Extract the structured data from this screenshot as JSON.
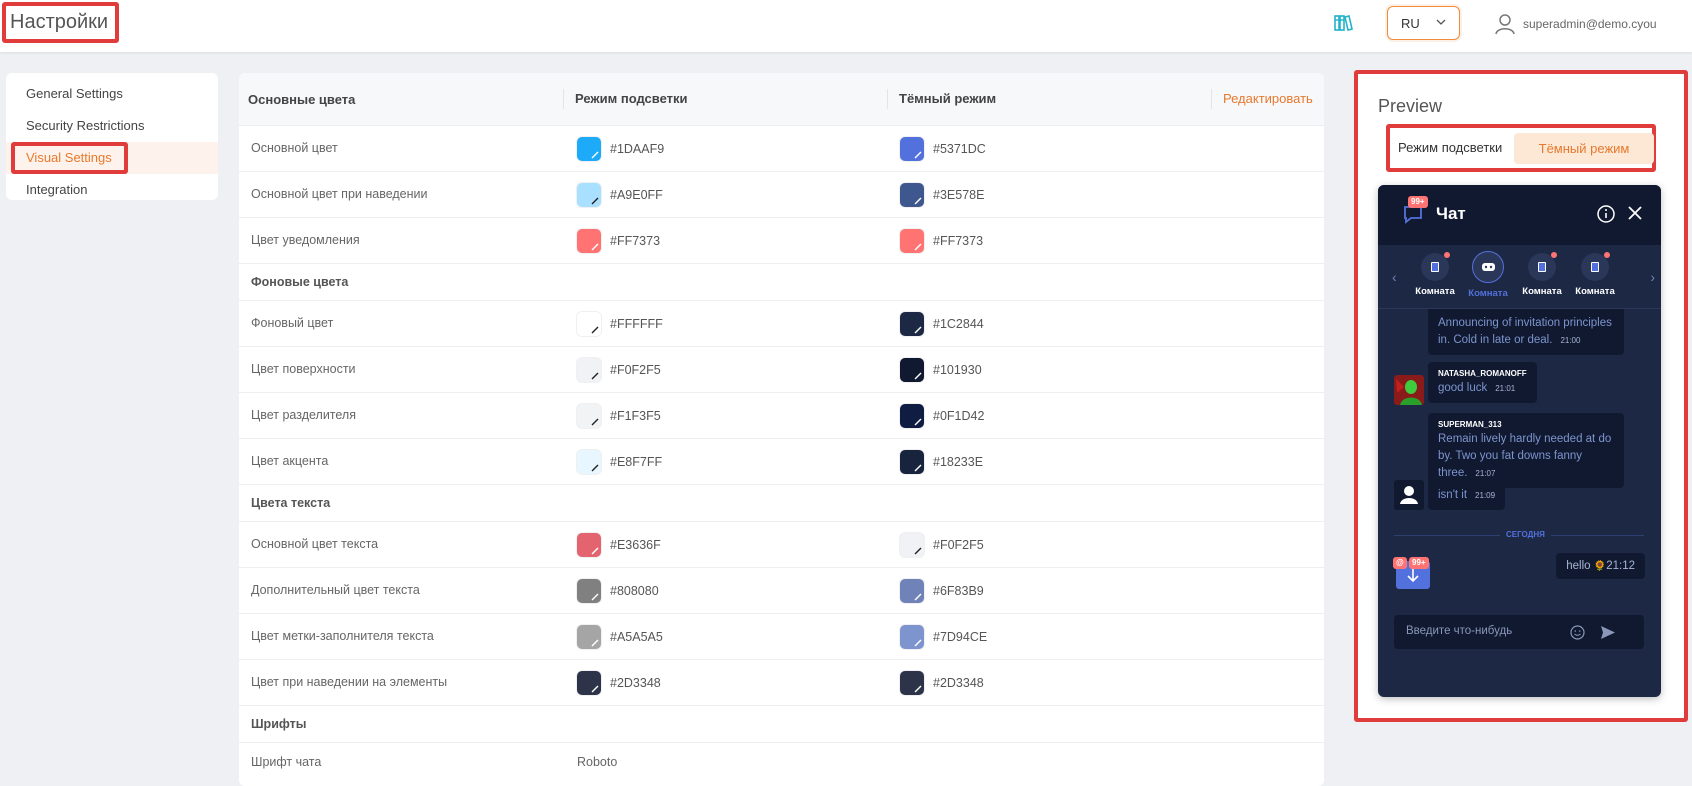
{
  "header": {
    "title": "Настройки",
    "lang": "RU",
    "user": "superadmin@demo.cyou"
  },
  "nav": {
    "items": [
      {
        "label": "General Settings"
      },
      {
        "label": "Security Restrictions"
      },
      {
        "label": "Visual Settings"
      },
      {
        "label": "Integration"
      }
    ]
  },
  "table": {
    "headers": {
      "main_colors": "Основные цвета",
      "light_mode": "Режим подсветки",
      "dark_mode": "Тёмный режим",
      "edit": "Редактировать"
    },
    "rows_main": [
      {
        "label": "Основной цвет",
        "light": "#1DAAF9",
        "dark": "#5371DC"
      },
      {
        "label": "Основной цвет при наведении",
        "light": "#A9E0FF",
        "dark": "#3E578E"
      },
      {
        "label": "Цвет уведомления",
        "light": "#FF7373",
        "dark": "#FF7373"
      }
    ],
    "section_bg": "Фоновые цвета",
    "rows_bg": [
      {
        "label": "Фоновый цвет",
        "light": "#FFFFFF",
        "dark": "#1C2844"
      },
      {
        "label": "Цвет поверхности",
        "light": "#F0F2F5",
        "dark": "#101930"
      },
      {
        "label": "Цвет разделителя",
        "light": "#F1F3F5",
        "dark": "#0F1D42"
      },
      {
        "label": "Цвет акцента",
        "light": "#E8F7FF",
        "dark": "#18233E"
      }
    ],
    "section_text": "Цвета текста",
    "rows_text": [
      {
        "label": "Основной цвет текста",
        "light": "#E3636F",
        "dark": "#F0F2F5"
      },
      {
        "label": "Дополнительный цвет текста",
        "light": "#808080",
        "dark": "#6F83B9"
      },
      {
        "label": "Цвет метки-заполнителя текста",
        "light": "#A5A5A5",
        "dark": "#7D94CE"
      },
      {
        "label": "Цвет при наведении на элементы",
        "light": "#2D3348",
        "dark": "#2D3348"
      }
    ],
    "section_fonts": "Шрифты",
    "font_row": {
      "label": "Шрифт чата",
      "value": "Roboto"
    }
  },
  "preview": {
    "title": "Preview",
    "mode_light": "Режим подсветки",
    "mode_dark": "Тёмный режим",
    "chat": {
      "title": "Чат",
      "unread_badge": "99+",
      "rooms": [
        {
          "name": "Комната",
          "selected": false
        },
        {
          "name": "Комната",
          "selected": true
        },
        {
          "name": "Комната",
          "selected": false
        },
        {
          "name": "Комната",
          "selected": false
        }
      ],
      "messages": [
        {
          "author": "",
          "text": "Announcing of invitation principles in. Cold in late or deal.",
          "time": "21:00"
        },
        {
          "author": "NATASHA_ROMANOFF",
          "text": "good luck",
          "time": "21:01"
        },
        {
          "author": "SUPERMAN_313",
          "text": "Remain lively hardly needed at do by. Two you fat downs fanny three.",
          "time": "21:07"
        },
        {
          "author": "",
          "text": "isn't it",
          "time": "21:09"
        }
      ],
      "divider": "СЕГОДНЯ",
      "mention_badge": "@",
      "scroll_badge": "99+",
      "outgoing": {
        "text": "hello",
        "emoji": "🌻",
        "time": "21:12"
      },
      "input_placeholder": "Введите что-нибудь"
    }
  },
  "colors": {
    "accent": "#e8792c",
    "highlight": "#e03c3c",
    "chat_bg": "#1c2844",
    "chat_surface": "#101930"
  }
}
